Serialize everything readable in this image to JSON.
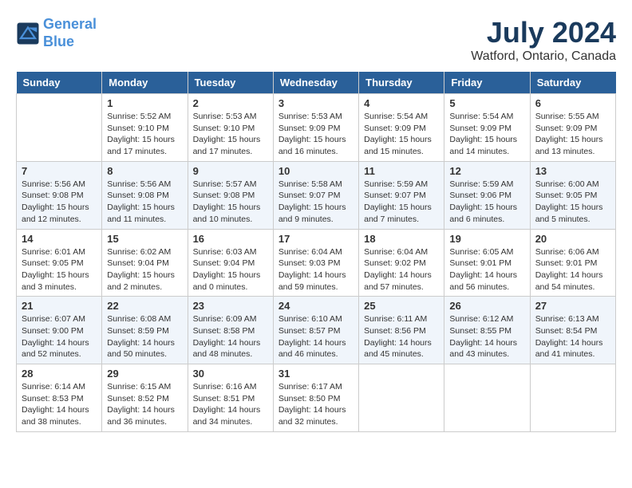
{
  "logo": {
    "line1": "General",
    "line2": "Blue"
  },
  "title": "July 2024",
  "location": "Watford, Ontario, Canada",
  "days_of_week": [
    "Sunday",
    "Monday",
    "Tuesday",
    "Wednesday",
    "Thursday",
    "Friday",
    "Saturday"
  ],
  "weeks": [
    [
      {
        "day": "",
        "info": ""
      },
      {
        "day": "1",
        "info": "Sunrise: 5:52 AM\nSunset: 9:10 PM\nDaylight: 15 hours\nand 17 minutes."
      },
      {
        "day": "2",
        "info": "Sunrise: 5:53 AM\nSunset: 9:10 PM\nDaylight: 15 hours\nand 17 minutes."
      },
      {
        "day": "3",
        "info": "Sunrise: 5:53 AM\nSunset: 9:09 PM\nDaylight: 15 hours\nand 16 minutes."
      },
      {
        "day": "4",
        "info": "Sunrise: 5:54 AM\nSunset: 9:09 PM\nDaylight: 15 hours\nand 15 minutes."
      },
      {
        "day": "5",
        "info": "Sunrise: 5:54 AM\nSunset: 9:09 PM\nDaylight: 15 hours\nand 14 minutes."
      },
      {
        "day": "6",
        "info": "Sunrise: 5:55 AM\nSunset: 9:09 PM\nDaylight: 15 hours\nand 13 minutes."
      }
    ],
    [
      {
        "day": "7",
        "info": "Sunrise: 5:56 AM\nSunset: 9:08 PM\nDaylight: 15 hours\nand 12 minutes."
      },
      {
        "day": "8",
        "info": "Sunrise: 5:56 AM\nSunset: 9:08 PM\nDaylight: 15 hours\nand 11 minutes."
      },
      {
        "day": "9",
        "info": "Sunrise: 5:57 AM\nSunset: 9:08 PM\nDaylight: 15 hours\nand 10 minutes."
      },
      {
        "day": "10",
        "info": "Sunrise: 5:58 AM\nSunset: 9:07 PM\nDaylight: 15 hours\nand 9 minutes."
      },
      {
        "day": "11",
        "info": "Sunrise: 5:59 AM\nSunset: 9:07 PM\nDaylight: 15 hours\nand 7 minutes."
      },
      {
        "day": "12",
        "info": "Sunrise: 5:59 AM\nSunset: 9:06 PM\nDaylight: 15 hours\nand 6 minutes."
      },
      {
        "day": "13",
        "info": "Sunrise: 6:00 AM\nSunset: 9:05 PM\nDaylight: 15 hours\nand 5 minutes."
      }
    ],
    [
      {
        "day": "14",
        "info": "Sunrise: 6:01 AM\nSunset: 9:05 PM\nDaylight: 15 hours\nand 3 minutes."
      },
      {
        "day": "15",
        "info": "Sunrise: 6:02 AM\nSunset: 9:04 PM\nDaylight: 15 hours\nand 2 minutes."
      },
      {
        "day": "16",
        "info": "Sunrise: 6:03 AM\nSunset: 9:04 PM\nDaylight: 15 hours\nand 0 minutes."
      },
      {
        "day": "17",
        "info": "Sunrise: 6:04 AM\nSunset: 9:03 PM\nDaylight: 14 hours\nand 59 minutes."
      },
      {
        "day": "18",
        "info": "Sunrise: 6:04 AM\nSunset: 9:02 PM\nDaylight: 14 hours\nand 57 minutes."
      },
      {
        "day": "19",
        "info": "Sunrise: 6:05 AM\nSunset: 9:01 PM\nDaylight: 14 hours\nand 56 minutes."
      },
      {
        "day": "20",
        "info": "Sunrise: 6:06 AM\nSunset: 9:01 PM\nDaylight: 14 hours\nand 54 minutes."
      }
    ],
    [
      {
        "day": "21",
        "info": "Sunrise: 6:07 AM\nSunset: 9:00 PM\nDaylight: 14 hours\nand 52 minutes."
      },
      {
        "day": "22",
        "info": "Sunrise: 6:08 AM\nSunset: 8:59 PM\nDaylight: 14 hours\nand 50 minutes."
      },
      {
        "day": "23",
        "info": "Sunrise: 6:09 AM\nSunset: 8:58 PM\nDaylight: 14 hours\nand 48 minutes."
      },
      {
        "day": "24",
        "info": "Sunrise: 6:10 AM\nSunset: 8:57 PM\nDaylight: 14 hours\nand 46 minutes."
      },
      {
        "day": "25",
        "info": "Sunrise: 6:11 AM\nSunset: 8:56 PM\nDaylight: 14 hours\nand 45 minutes."
      },
      {
        "day": "26",
        "info": "Sunrise: 6:12 AM\nSunset: 8:55 PM\nDaylight: 14 hours\nand 43 minutes."
      },
      {
        "day": "27",
        "info": "Sunrise: 6:13 AM\nSunset: 8:54 PM\nDaylight: 14 hours\nand 41 minutes."
      }
    ],
    [
      {
        "day": "28",
        "info": "Sunrise: 6:14 AM\nSunset: 8:53 PM\nDaylight: 14 hours\nand 38 minutes."
      },
      {
        "day": "29",
        "info": "Sunrise: 6:15 AM\nSunset: 8:52 PM\nDaylight: 14 hours\nand 36 minutes."
      },
      {
        "day": "30",
        "info": "Sunrise: 6:16 AM\nSunset: 8:51 PM\nDaylight: 14 hours\nand 34 minutes."
      },
      {
        "day": "31",
        "info": "Sunrise: 6:17 AM\nSunset: 8:50 PM\nDaylight: 14 hours\nand 32 minutes."
      },
      {
        "day": "",
        "info": ""
      },
      {
        "day": "",
        "info": ""
      },
      {
        "day": "",
        "info": ""
      }
    ]
  ]
}
